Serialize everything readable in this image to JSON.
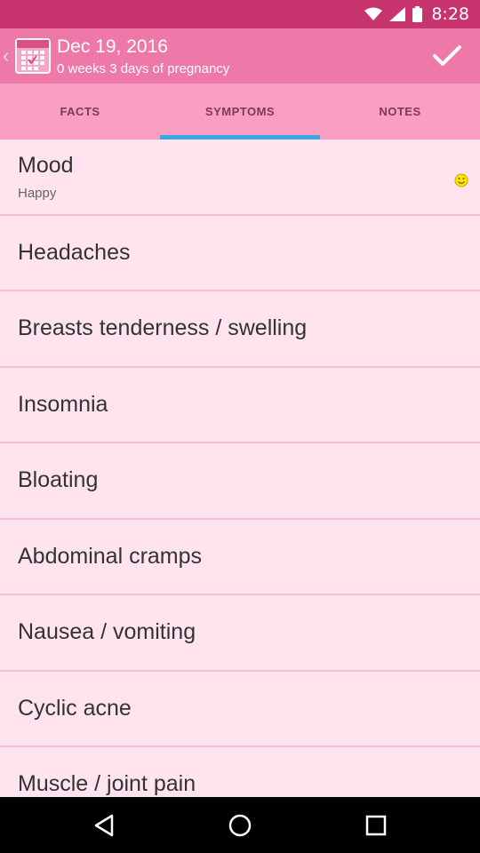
{
  "status": {
    "time": "8:28"
  },
  "header": {
    "title": "Dec 19, 2016",
    "subtitle": "0 weeks 3 days of pregnancy"
  },
  "tabs": [
    {
      "label": "FACTS"
    },
    {
      "label": "SYMPTOMS"
    },
    {
      "label": "NOTES"
    }
  ],
  "symptoms": [
    {
      "title": "Mood",
      "value": "Happy"
    },
    {
      "title": "Headaches"
    },
    {
      "title": "Breasts tenderness / swelling"
    },
    {
      "title": "Insomnia"
    },
    {
      "title": "Bloating"
    },
    {
      "title": "Abdominal cramps"
    },
    {
      "title": "Nausea / vomiting"
    },
    {
      "title": "Cyclic acne"
    },
    {
      "title": "Muscle / joint pain"
    }
  ],
  "colors": {
    "status_bar": "#c7336d",
    "app_bar": "#ee78a7",
    "tab_bar": "#fa9fc3",
    "tab_indicator": "#3ca7e3",
    "list_background": "#ffe4ef"
  },
  "icons": {
    "app": "calendar-icon",
    "confirm": "checkmark-icon",
    "mood": "smiley-icon",
    "nav": [
      "back-icon",
      "home-icon",
      "recents-icon"
    ]
  }
}
